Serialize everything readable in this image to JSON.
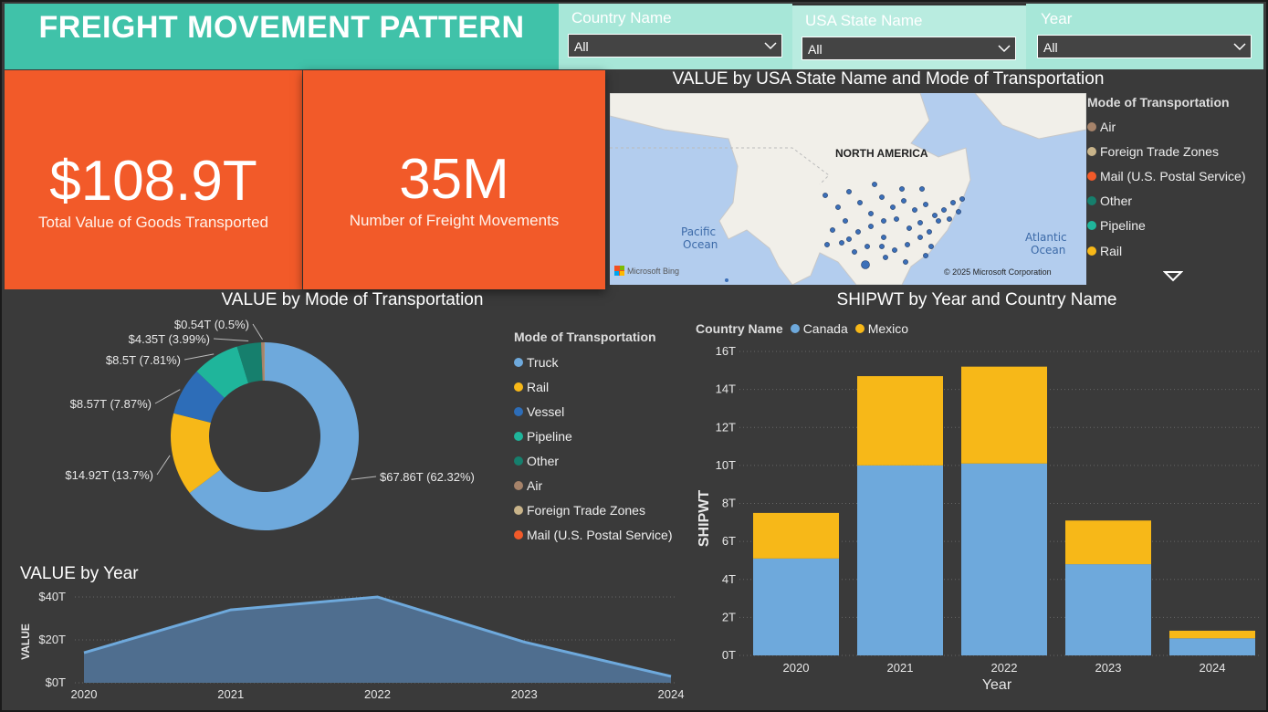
{
  "header": {
    "title": "FREIGHT MOVEMENT PATTERN"
  },
  "filters": [
    {
      "label": "Country Name",
      "value": "All"
    },
    {
      "label": "USA State Name",
      "value": "All"
    },
    {
      "label": "Year",
      "value": "All"
    }
  ],
  "kpis": [
    {
      "value": "$108.9T",
      "label": "Total Value of Goods Transported"
    },
    {
      "value": "35M",
      "label": "Number of Freight Movements"
    }
  ],
  "map": {
    "title": "VALUE by USA State Name and Mode of Transportation",
    "labels": {
      "continent": "NORTH AMERICA",
      "pacific": "Pacific\nOcean",
      "pacific_1": "Pacific",
      "pacific_2": "Ocean",
      "atlantic_1": "Atlantic",
      "atlantic_2": "Ocean"
    },
    "attribution": "© 2025 Microsoft Corporation",
    "brand": "Microsoft Bing",
    "legend_title": "Mode of Transportation",
    "legend": [
      {
        "name": "Air",
        "color": "#a6836a"
      },
      {
        "name": "Foreign Trade Zones",
        "color": "#c9b48a"
      },
      {
        "name": "Mail (U.S. Postal Service)",
        "color": "#f25a29"
      },
      {
        "name": "Other",
        "color": "#167f6d"
      },
      {
        "name": "Pipeline",
        "color": "#1fb59b"
      },
      {
        "name": "Rail",
        "color": "#f7b818"
      }
    ]
  },
  "donut": {
    "title": "VALUE by Mode of Transportation",
    "legend_title": "Mode of Transportation",
    "legend": [
      {
        "name": "Truck",
        "color": "#6ea9dc"
      },
      {
        "name": "Rail",
        "color": "#f7b818"
      },
      {
        "name": "Vessel",
        "color": "#2d6db8"
      },
      {
        "name": "Pipeline",
        "color": "#1fb59b"
      },
      {
        "name": "Other",
        "color": "#167f6d"
      },
      {
        "name": "Air",
        "color": "#a6836a"
      },
      {
        "name": "Foreign Trade Zones",
        "color": "#c9b48a"
      },
      {
        "name": "Mail (U.S. Postal Service)",
        "color": "#f25a29"
      }
    ]
  },
  "bar": {
    "title": "SHIPWT by Year and Country Name",
    "legend_title": "Country Name",
    "legend": [
      {
        "name": "Canada",
        "color": "#6ea9dc"
      },
      {
        "name": "Mexico",
        "color": "#f7b818"
      }
    ]
  },
  "area": {
    "title": "VALUE by Year"
  },
  "chart_data": [
    {
      "type": "pie",
      "title": "VALUE by Mode of Transportation",
      "categories": [
        "Truck",
        "Rail",
        "Vessel",
        "Pipeline",
        "Other",
        "Air",
        "Foreign Trade Zones",
        "Mail (U.S. Postal Service)"
      ],
      "values": [
        67.86,
        14.92,
        8.57,
        8.5,
        4.35,
        0.54,
        0.1,
        0.01
      ],
      "labels": [
        "$67.86T (62.32%)",
        "$14.92T (13.7%)",
        "$8.57T (7.87%)",
        "$8.5T (7.81%)",
        "$4.35T (3.99%)",
        "$0.54T (0.5%)",
        "",
        ""
      ],
      "colors": [
        "#6ea9dc",
        "#f7b818",
        "#2d6db8",
        "#1fb59b",
        "#167f6d",
        "#a6836a",
        "#c9b48a",
        "#f25a29"
      ]
    },
    {
      "type": "bar",
      "title": "SHIPWT by Year and Country Name",
      "xlabel": "Year",
      "ylabel": "SHIPWT",
      "categories": [
        "2020",
        "2021",
        "2022",
        "2023",
        "2024"
      ],
      "series": [
        {
          "name": "Canada",
          "values": [
            5.1,
            10.0,
            10.1,
            4.8,
            0.9
          ]
        },
        {
          "name": "Mexico",
          "values": [
            2.4,
            4.7,
            5.1,
            2.3,
            0.4
          ]
        }
      ],
      "ylim": [
        0,
        16
      ],
      "yticks": [
        "0T",
        "2T",
        "4T",
        "6T",
        "8T",
        "10T",
        "12T",
        "14T",
        "16T"
      ],
      "legend": "top-left",
      "grid": true
    },
    {
      "type": "area",
      "title": "VALUE by Year",
      "ylabel": "VALUE",
      "categories": [
        "2020",
        "2021",
        "2022",
        "2023",
        "2024"
      ],
      "values": [
        14,
        34,
        40,
        19,
        3
      ],
      "ylim": [
        0,
        40
      ],
      "yticks": [
        "$0T",
        "$20T",
        "$40T"
      ],
      "grid": true
    }
  ]
}
